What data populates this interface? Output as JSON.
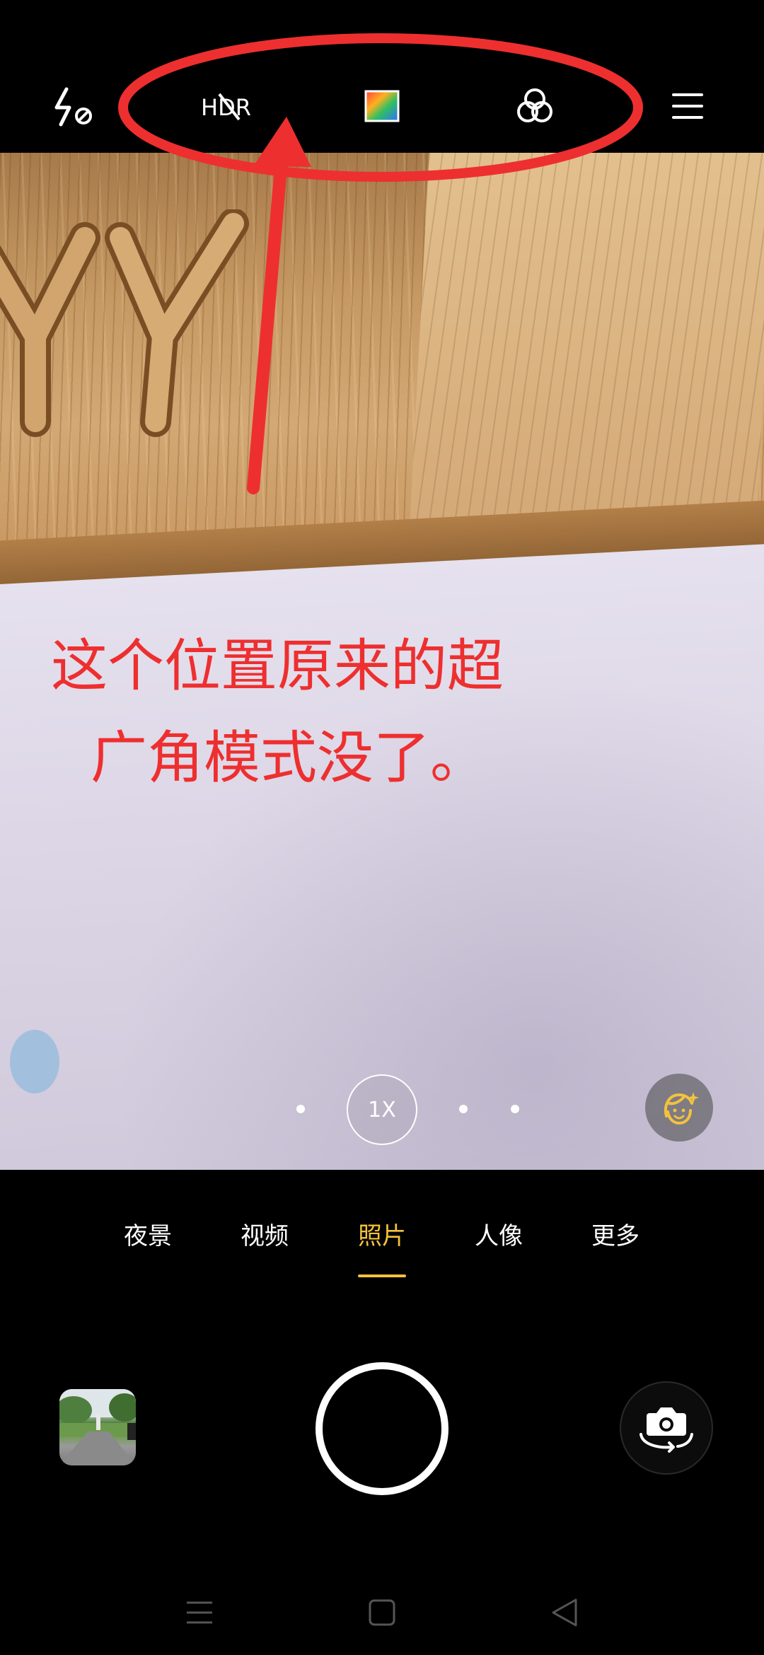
{
  "topbar": {
    "icons": [
      "flash-auto-icon",
      "hdr-off-icon",
      "color-filter-icon",
      "filters-icon",
      "menu-icon"
    ],
    "hdr_label": "HDR"
  },
  "viewfinder": {
    "annotation_line1": "这个位置原来的超",
    "annotation_line2": "广角模式没了。",
    "annotation_color": "#ee2f2f",
    "zoom_label": "1X"
  },
  "modes": {
    "items": [
      "夜景",
      "视频",
      "照片",
      "人像",
      "更多"
    ],
    "active": "照片",
    "active_color": "#f3c23c"
  },
  "navbar": {
    "icons": [
      "recent-apps-icon",
      "home-icon",
      "back-icon"
    ]
  }
}
